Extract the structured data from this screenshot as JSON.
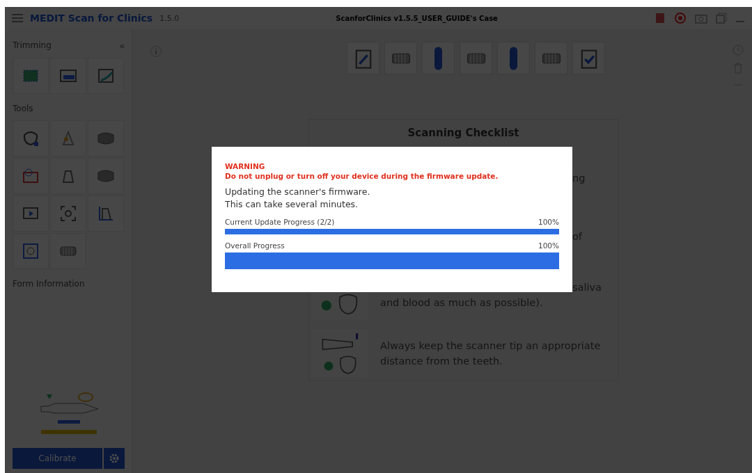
{
  "window": {
    "app_name": "MEDIT Scan for Clinics",
    "version": "1.5.0",
    "case_title": "ScanforClinics v1.5.5_USER_GUIDE's Case"
  },
  "sidebar": {
    "trimming_title": "Trimming",
    "collapse": "«",
    "tools_title": "Tools",
    "form_title": "Form Information",
    "calibrate": "Calibrate"
  },
  "checklist": {
    "title": "Scanning Checklist",
    "items": [
      {
        "kind": "partial",
        "lines": [
          "ng"
        ]
      },
      {
        "kind": "partial",
        "lines": [
          "of"
        ]
      },
      {
        "kind": "tooth",
        "lines": [
          "saliva",
          "and blood as much as possible)."
        ]
      },
      {
        "kind": "scanner",
        "lines": [
          "Always keep the scanner tip an appropriate",
          "distance from the teeth."
        ]
      }
    ]
  },
  "dialog": {
    "warning_title": "WARNING",
    "warning_text": "Do not unplug or turn off your device during the firmware update.",
    "message": [
      "Updating the scanner's firmware.",
      "This can take several minutes."
    ],
    "progress": [
      {
        "kind": "thin",
        "label": "Current Update Progress (2/2)",
        "reading": "100%",
        "level": 1
      },
      {
        "kind": "thick",
        "label": "Overall Progress",
        "reading": "100%",
        "level": 1
      }
    ]
  }
}
